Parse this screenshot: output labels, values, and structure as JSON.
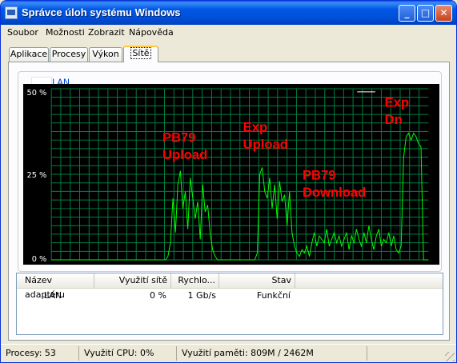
{
  "window": {
    "title": "Správce úloh systému Windows"
  },
  "titlebar_buttons": {
    "minimize": "_",
    "maximize": "□",
    "close": "✕"
  },
  "menu": [
    "Soubor",
    "Možnosti",
    "Zobrazit",
    "Nápověda"
  ],
  "tabs": [
    "Aplikace",
    "Procesy",
    "Výkon",
    "Sítě"
  ],
  "active_tab": "Sítě",
  "graph": {
    "legend_label": "LAN",
    "y_ticks": [
      "50 %",
      "25 %",
      "0 %"
    ],
    "y_max": 50,
    "line_color": "#00ff00",
    "grid_color": "#008040",
    "annotation_color": "#ff0000",
    "annotations": [
      {
        "line1": "PB79",
        "line2": "Upload"
      },
      {
        "line1": "Exp",
        "line2": "Upload"
      },
      {
        "line1": "PB79",
        "line2": "Download"
      },
      {
        "line1": "Exp",
        "line2": "Dn"
      }
    ]
  },
  "chart_data": {
    "type": "line",
    "title": "LAN",
    "ylabel": "Využití sítě",
    "ylim": [
      0,
      50
    ],
    "y_ticks": [
      "0 %",
      "25 %",
      "50 %"
    ],
    "grid": true,
    "series": [
      {
        "name": "LAN",
        "values": [
          0,
          0,
          0,
          0,
          0,
          0,
          0,
          0,
          0,
          0,
          0,
          0,
          0,
          0,
          0,
          0,
          0,
          0,
          0,
          0,
          0,
          0,
          0,
          0,
          0,
          0,
          0,
          0,
          0,
          0,
          0,
          0,
          0,
          0,
          0,
          0,
          0,
          0,
          0,
          0,
          0,
          0,
          0,
          0,
          0,
          0,
          0,
          1,
          5,
          18,
          8,
          22,
          26,
          15,
          20,
          9,
          24,
          18,
          12,
          17,
          6,
          22,
          14,
          16,
          8,
          3,
          1,
          0,
          0,
          0,
          0,
          0,
          0,
          0,
          0,
          0,
          0,
          0,
          0,
          0,
          0,
          0,
          0,
          2,
          25,
          27,
          20,
          18,
          24,
          15,
          22,
          12,
          23,
          17,
          19,
          10,
          20,
          8,
          4,
          2,
          1,
          3,
          2,
          4,
          1,
          5,
          8,
          4,
          7,
          6,
          5,
          9,
          4,
          6,
          8,
          5,
          7,
          4,
          6,
          8,
          3,
          7,
          5,
          9,
          6,
          4,
          8,
          5,
          10,
          6,
          3,
          7,
          9,
          4,
          6,
          5,
          8,
          4,
          7,
          3,
          2,
          4,
          30,
          36,
          37,
          35,
          37,
          36,
          34,
          33,
          0,
          0,
          0
        ]
      }
    ]
  },
  "list": {
    "columns": [
      "Název adaptéru",
      "Využití sítě",
      "Rychlo...",
      "Stav"
    ],
    "rows": [
      {
        "name": "LAN",
        "usage": "0 %",
        "speed": "1 Gb/s",
        "state": "Funkční"
      }
    ]
  },
  "status": {
    "processes": "Procesy: 53",
    "cpu": "Využití CPU: 0%",
    "memory": "Využití paměti: 809M / 2462M"
  }
}
